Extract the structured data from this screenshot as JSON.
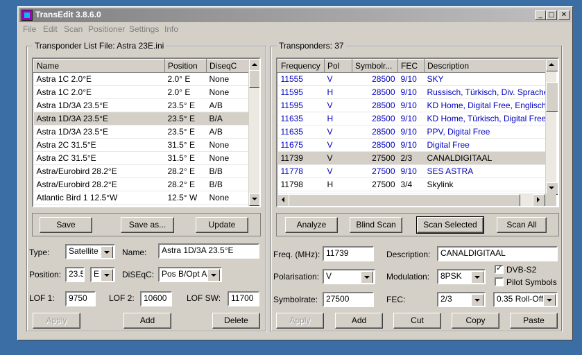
{
  "window": {
    "title": "TransEdit 3.8.6.0"
  },
  "menu": [
    "File",
    "Edit",
    "Scan",
    "Positioner",
    "Settings",
    "Info"
  ],
  "left": {
    "group_title": "Transponder List File:  Astra 23E.ini",
    "columns": [
      "Name",
      "Position",
      "DiseqC"
    ],
    "rows": [
      [
        "Astra 1C 2.0°E",
        "2.0° E",
        "None"
      ],
      [
        "Astra 1C 2.0°E",
        "2.0° E",
        "None"
      ],
      [
        "Astra 1D/3A 23.5°E",
        "23.5° E",
        "A/B"
      ],
      [
        "Astra 1D/3A 23.5°E",
        "23.5° E",
        "B/A"
      ],
      [
        "Astra 1D/3A 23.5°E",
        "23.5° E",
        "A/B"
      ],
      [
        "Astra 2C 31.5°E",
        "31.5° E",
        "None"
      ],
      [
        "Astra 2C 31.5°E",
        "31.5° E",
        "None"
      ],
      [
        "Astra/Eurobird 28.2°E",
        "28.2° E",
        "B/B"
      ],
      [
        "Astra/Eurobird 28.2°E",
        "28.2° E",
        "B/B"
      ],
      [
        "Atlantic Bird 1 12.5°W",
        "12.5° W",
        "None"
      ]
    ],
    "selected_row": 3,
    "buttons": {
      "save": "Save",
      "save_as": "Save as...",
      "update": "Update"
    },
    "form": {
      "type_label": "Type:",
      "type_value": "Satellite",
      "name_label": "Name:",
      "name_value": "Astra 1D/3A 23.5°E",
      "position_label": "Position:",
      "position_value": "23.5",
      "position_dir": "E",
      "diseqc_label": "DiSEqC:",
      "diseqc_value": "Pos B/Opt A",
      "lof1_label": "LOF 1:",
      "lof1_value": "9750",
      "lof2_label": "LOF 2:",
      "lof2_value": "10600",
      "lofsw_label": "LOF SW:",
      "lofsw_value": "11700"
    },
    "actions": {
      "apply": "Apply",
      "add": "Add",
      "delete": "Delete"
    }
  },
  "right": {
    "group_title": "Transponders: 37",
    "columns": [
      "Frequency",
      "Pol",
      "Symbolr...",
      "FEC",
      "Description"
    ],
    "rows": [
      [
        "11555",
        "V",
        "28500",
        "9/10",
        "SKY",
        true
      ],
      [
        "11595",
        "H",
        "28500",
        "9/10",
        "Russisch, Türkisch, Div. Sprachen",
        true
      ],
      [
        "11595",
        "V",
        "28500",
        "9/10",
        "KD Home, Digital Free, Englisch,",
        true
      ],
      [
        "11635",
        "H",
        "28500",
        "9/10",
        "KD Home, Türkisch, Digital Free,",
        true
      ],
      [
        "11635",
        "V",
        "28500",
        "9/10",
        "PPV, Digital Free",
        true
      ],
      [
        "11675",
        "V",
        "28500",
        "9/10",
        "Digital Free",
        true
      ],
      [
        "11739",
        "V",
        "27500",
        "2/3",
        "CANALDIGITAAL",
        false
      ],
      [
        "11778",
        "V",
        "27500",
        "9/10",
        "SES ASTRA",
        true
      ],
      [
        "11798",
        "H",
        "27500",
        "3/4",
        "Skylink",
        false
      ]
    ],
    "selected_row": 6,
    "buttons": {
      "analyze": "Analyze",
      "blind_scan": "Blind Scan",
      "scan_selected": "Scan Selected",
      "scan_all": "Scan All"
    },
    "form": {
      "freq_label": "Freq. (MHz):",
      "freq_value": "11739",
      "desc_label": "Description:",
      "desc_value": "CANALDIGITAAL",
      "pol_label": "Polarisation:",
      "pol_value": "V",
      "mod_label": "Modulation:",
      "mod_value": "8PSK",
      "dvbs2_label": "DVB-S2",
      "pilot_label": "Pilot Symbols",
      "sr_label": "Symbolrate:",
      "sr_value": "27500",
      "fec_label": "FEC:",
      "fec_value": "2/3",
      "rolloff_value": "0.35 Roll-Off"
    },
    "actions": {
      "apply": "Apply",
      "add": "Add",
      "cut": "Cut",
      "copy": "Copy",
      "paste": "Paste"
    }
  }
}
